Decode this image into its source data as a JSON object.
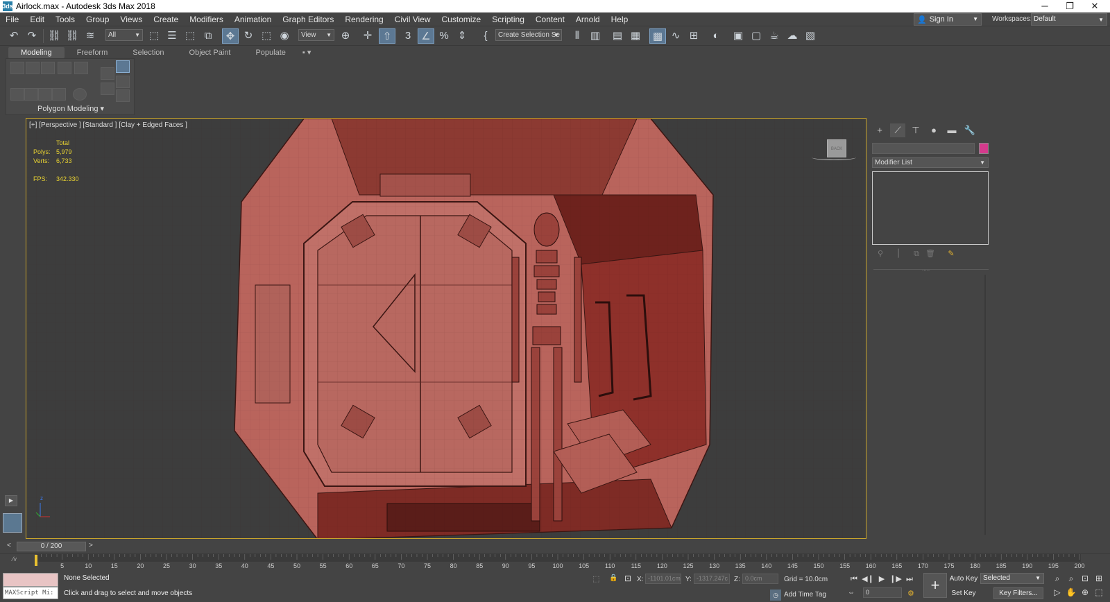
{
  "titlebar": {
    "title": "Airlock.max - Autodesk 3ds Max 2018",
    "app_icon": "3ds",
    "minimize": "─",
    "restore": "❐",
    "close": "✕"
  },
  "menu": [
    "File",
    "Edit",
    "Tools",
    "Group",
    "Views",
    "Create",
    "Modifiers",
    "Animation",
    "Graph Editors",
    "Rendering",
    "Civil View",
    "Customize",
    "Scripting",
    "Content",
    "Arnold",
    "Help"
  ],
  "account": {
    "sign_in": "Sign In",
    "workspaces_label": "Workspaces:",
    "workspace": "Default"
  },
  "toolbar": {
    "selection_filter": "All",
    "ref_coord": "View",
    "named_selection": "Create Selection Se",
    "icons": {
      "undo": "↶",
      "redo": "↷",
      "link": "⛓",
      "unlink": "⛓",
      "bind": "≋",
      "select": "⬚",
      "select_name": "☰",
      "rect_region": "⬚",
      "window_crossing": "⧉",
      "move": "✥",
      "rotate": "↻",
      "scale": "⬚",
      "placement": "◉",
      "pivot": "⊕",
      "manip": "✛",
      "keyboard": "⇧",
      "snap": "3",
      "angle_snap": "∠",
      "percent_snap": "%",
      "spinner_snap": "⇕",
      "edit_named": "{",
      "mirror": "⫴",
      "align": "▥",
      "layer": "▤",
      "ribbon": "▦",
      "graph": "▩",
      "curve": "∿",
      "schematic": "⊞",
      "material": "◐",
      "render_setup": "▣",
      "render_frame": "▢",
      "render": "☕",
      "render_cloud": "☁",
      "a360": "▧"
    }
  },
  "ribbon": {
    "tabs": [
      "Modeling",
      "Freeform",
      "Selection",
      "Object Paint",
      "Populate"
    ],
    "tab_extra": "▪ ▾",
    "panel_label": "Polygon Modeling ▾"
  },
  "viewport": {
    "label": "[+] [Perspective ] [Standard ] [Clay + Edged Faces ]",
    "stats": {
      "header": "Total",
      "polys_label": "Polys:",
      "polys": "5,979",
      "verts_label": "Verts:",
      "verts": "6,733",
      "fps_label": "FPS:",
      "fps": "342.330"
    },
    "viewcube": "BACK",
    "axis": {
      "z": "z"
    }
  },
  "command_panel": {
    "tabs": {
      "create": "+",
      "modify": "⟋",
      "hierarchy": "⊤",
      "motion": "●",
      "display": "▬",
      "utilities": "🔧"
    },
    "object_color": "#d43a8c",
    "modifier_list": "Modifier List",
    "stack_icons": {
      "pin": "⚲",
      "show_end": "⎮",
      "unique": "⧉",
      "remove": "🗑",
      "configure": "✎"
    },
    "divider_dots": "....."
  },
  "timeline": {
    "slider": "0 / 200",
    "prev": "<",
    "next": ">",
    "ticks": [
      "5",
      "10",
      "15",
      "20",
      "25",
      "30",
      "35",
      "40",
      "45",
      "50",
      "55",
      "60",
      "65",
      "70",
      "75",
      "80",
      "85",
      "90",
      "95",
      "100",
      "105",
      "110",
      "115",
      "120",
      "125",
      "130",
      "135",
      "140",
      "145",
      "150",
      "155",
      "160",
      "165",
      "170",
      "175",
      "180",
      "185",
      "190",
      "195",
      "200"
    ],
    "mini_curve": "⁄v"
  },
  "status": {
    "maxscript": "MAXScript Mi:",
    "selection": "None Selected",
    "prompt": "Click and drag to select and move objects",
    "x_label": "X:",
    "x": "-1101.01cm",
    "y_label": "Y:",
    "y": "-1317.247c",
    "z_label": "Z:",
    "z": "0.0cm",
    "grid": "Grid = 10.0cm",
    "add_time_tag": "Add Time Tag",
    "auto_key": "Auto Key",
    "set_key": "Set Key",
    "selected": "Selected",
    "key_filters": "Key Filters...",
    "frame": "0",
    "playback": {
      "start": "⏮",
      "prev": "◀❙",
      "play": "▶",
      "next": "❙▶",
      "end": "⏭"
    },
    "key_big": "+"
  }
}
